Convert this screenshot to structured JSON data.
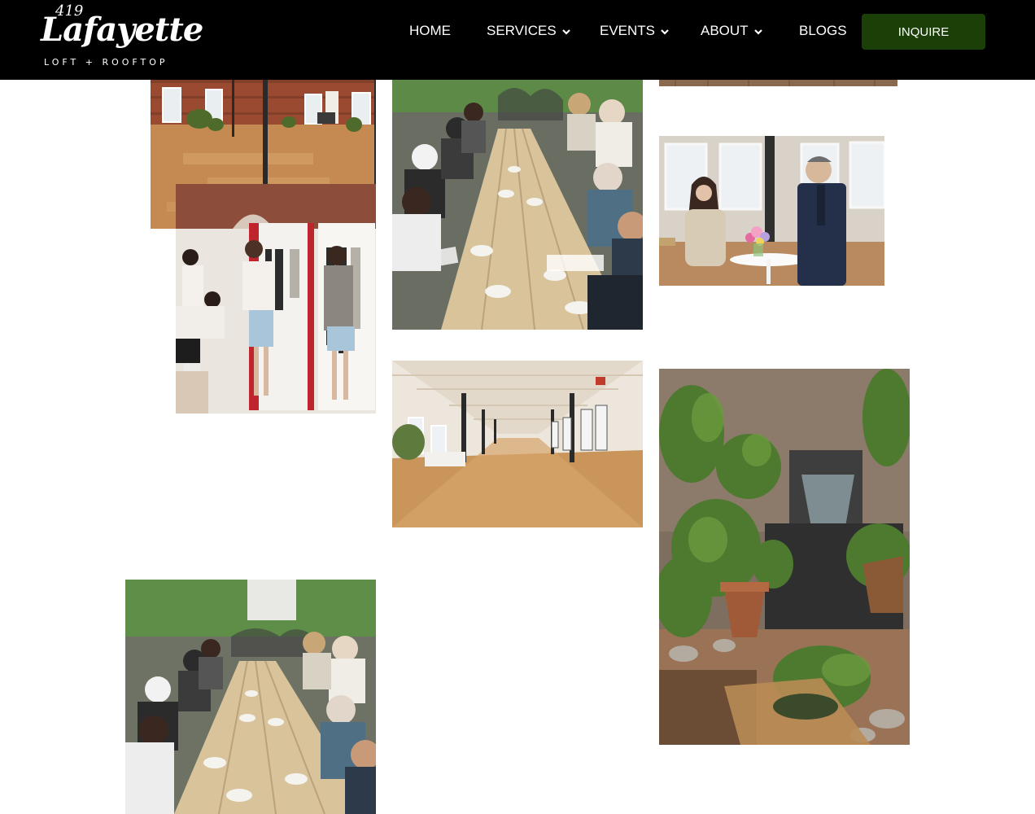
{
  "header": {
    "logo": {
      "number": "419",
      "wordmark": "Lafayette",
      "tagline": "LOFT + ROOFTOP"
    },
    "nav": [
      {
        "label": "HOME",
        "has_dropdown": false
      },
      {
        "label": "SERVICES",
        "has_dropdown": true
      },
      {
        "label": "EVENTS",
        "has_dropdown": true
      },
      {
        "label": "ABOUT",
        "has_dropdown": true
      },
      {
        "label": "BLOGS",
        "has_dropdown": false
      }
    ],
    "cta_label": "INQUIRE",
    "colors": {
      "background": "#000000",
      "cta": "#1a4008",
      "text": "#ffffff"
    }
  },
  "gallery": {
    "photos": [
      {
        "name": "loft-interior-photo"
      },
      {
        "name": "rooftop-dinner-photo"
      },
      {
        "name": "floor-detail-photo"
      },
      {
        "name": "conversation-photo"
      },
      {
        "name": "clothing-racks-photo"
      },
      {
        "name": "long-loft-hall-photo"
      },
      {
        "name": "plants-fountain-photo"
      },
      {
        "name": "rooftop-dinner-photo-2"
      }
    ]
  }
}
